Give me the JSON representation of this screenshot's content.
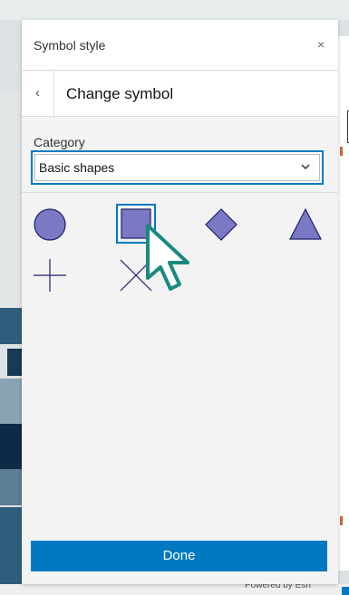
{
  "panel": {
    "title": "Symbol style",
    "close_glyph": "×",
    "back_glyph": "‹",
    "subtitle": "Change symbol"
  },
  "category": {
    "label": "Category",
    "selected": "Basic shapes"
  },
  "symbols": [
    {
      "name": "circle",
      "selected": false
    },
    {
      "name": "square",
      "selected": true
    },
    {
      "name": "diamond",
      "selected": false
    },
    {
      "name": "triangle",
      "selected": false
    },
    {
      "name": "cross",
      "selected": false
    },
    {
      "name": "x",
      "selected": false
    }
  ],
  "colors": {
    "symbol_fill": "#7b79c4",
    "symbol_stroke": "#1f1f6b",
    "accent": "#0079c1",
    "cursor_stroke": "#1a8a80"
  },
  "done_label": "Done",
  "map_credit": "Powered by Esri"
}
